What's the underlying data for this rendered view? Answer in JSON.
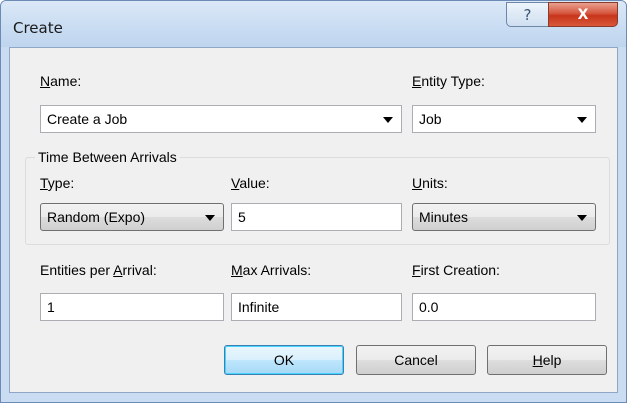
{
  "window": {
    "title": "Create",
    "help_glyph": "?",
    "close_glyph": "X"
  },
  "name": {
    "label_pre": "",
    "label_key": "N",
    "label_post": "ame:",
    "value": "Create a Job"
  },
  "entity_type": {
    "label_key": "E",
    "label_post": "ntity Type:",
    "value": "Job"
  },
  "time_between": {
    "title": "Time Between Arrivals",
    "type": {
      "label_key": "T",
      "label_post": "ype:",
      "value": "Random (Expo)"
    },
    "value": {
      "label_key": "V",
      "label_post": "alue:",
      "value": "5"
    },
    "units": {
      "label_key": "U",
      "label_post": "nits:",
      "value": "Minutes"
    }
  },
  "entities_per_arrival": {
    "label_pre": "Entities per ",
    "label_key": "A",
    "label_post": "rrival:",
    "value": "1"
  },
  "max_arrivals": {
    "label_key": "M",
    "label_post": "ax Arrivals:",
    "value": "Infinite"
  },
  "first_creation": {
    "label_key": "F",
    "label_post": "irst Creation:",
    "value": "0.0"
  },
  "buttons": {
    "ok": "OK",
    "cancel": "Cancel",
    "help_key": "H",
    "help_post": "elp"
  }
}
